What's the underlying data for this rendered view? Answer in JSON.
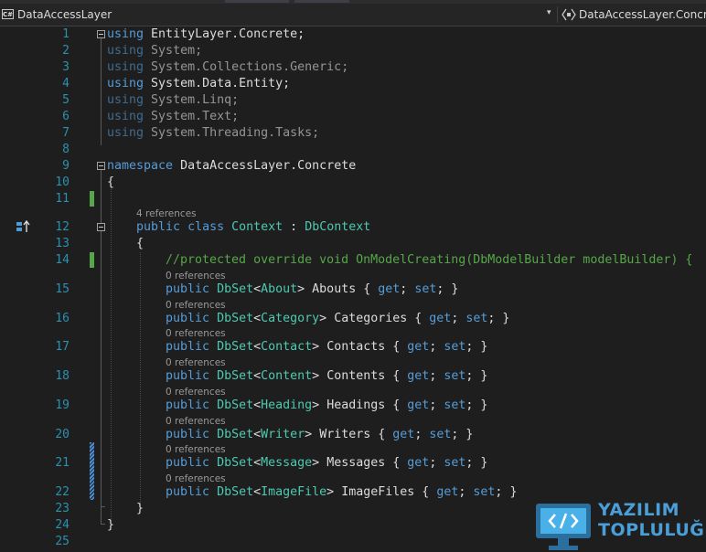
{
  "navbar": {
    "project_label": "DataAccessLayer",
    "project_icon_text": "C#",
    "namespace_label": "DataAccessLayer.Concrete",
    "dropdown_glyph": "▾"
  },
  "editor": {
    "lines": [
      {
        "n": "1"
      },
      {
        "n": "2"
      },
      {
        "n": "3"
      },
      {
        "n": "4"
      },
      {
        "n": "5"
      },
      {
        "n": "6"
      },
      {
        "n": "7"
      },
      {
        "n": "8"
      },
      {
        "n": "9"
      },
      {
        "n": "10"
      },
      {
        "n": "11"
      },
      {
        "n": "12"
      },
      {
        "n": "13"
      },
      {
        "n": "14"
      },
      {
        "n": "15"
      },
      {
        "n": "16"
      },
      {
        "n": "17"
      },
      {
        "n": "18"
      },
      {
        "n": "19"
      },
      {
        "n": "20"
      },
      {
        "n": "21"
      },
      {
        "n": "22"
      },
      {
        "n": "23"
      },
      {
        "n": "24"
      },
      {
        "n": "25"
      }
    ],
    "tokens": {
      "using": "using",
      "ns_entity_concrete": "EntityLayer.Concrete",
      "semicolon": ";",
      "system": "System",
      "system_collections_generic": "System.Collections.Generic",
      "system_data_entity": "System.Data.Entity",
      "system_linq": "System.Linq",
      "system_text": "System.Text",
      "system_threading_tasks": "System.Threading.Tasks",
      "namespace_kw": "namespace",
      "namespace_name": "DataAccessLayer.Concrete",
      "open_brace": "{",
      "close_brace": "}",
      "public": "public",
      "class": "class",
      "context": "Context",
      "colon": ":",
      "dbcontext": "DbContext",
      "comment_line": "//protected override void OnModelCreating(DbModelBuilder modelBuilder) {",
      "dbset": "DbSet",
      "lt": "<",
      "gt": ">",
      "get": "get",
      "set": "set",
      "about": "About",
      "abouts": "Abouts",
      "category": "Category",
      "categories": "Categories",
      "contact": "Contact",
      "contacts": "Contacts",
      "content": "Content",
      "contents": "Contents",
      "heading": "Heading",
      "headings": "Headings",
      "writer": "Writer",
      "writers": "Writers",
      "message": "Message",
      "messages": "Messages",
      "imagefile": "ImageFile",
      "imagefiles": "ImageFiles"
    },
    "codelens": {
      "class_refs": "4 references",
      "zero_refs": "0 references"
    }
  },
  "watermark": {
    "line1": "YAZILIM",
    "line2": "TOPLULUĞU",
    "color": "#4a9fd8"
  },
  "colors": {
    "background": "#1e1e1e",
    "keyword": "#569cd6",
    "type": "#4ec9b0",
    "comment": "#57a64a",
    "line_number": "#2b91af",
    "codelens": "#999999"
  }
}
